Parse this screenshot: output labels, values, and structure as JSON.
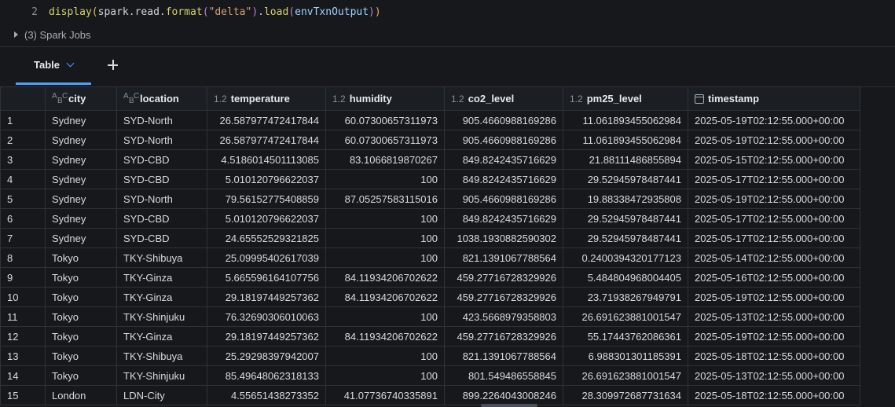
{
  "code": {
    "line_no": "2",
    "tokens": [
      "display",
      "(",
      "spark",
      ".",
      "read",
      ".",
      "format",
      "(",
      "\"delta\"",
      ")",
      ".",
      "load",
      "(",
      "envTxnOutput",
      ")",
      ")"
    ]
  },
  "jobs": {
    "label": "(3) Spark Jobs"
  },
  "tabs": {
    "active": "Table",
    "add": "+"
  },
  "columns": [
    {
      "name": "city",
      "type": "string"
    },
    {
      "name": "location",
      "type": "string"
    },
    {
      "name": "temperature",
      "type": "number",
      "type_label": "1.2"
    },
    {
      "name": "humidity",
      "type": "number",
      "type_label": "1.2"
    },
    {
      "name": "co2_level",
      "type": "number",
      "type_label": "1.2"
    },
    {
      "name": "pm25_level",
      "type": "number",
      "type_label": "1.2"
    },
    {
      "name": "timestamp",
      "type": "timestamp"
    }
  ],
  "rows": [
    [
      "1",
      "Sydney",
      "SYD-North",
      "26.587977472417844",
      "60.07300657311973",
      "905.4660988169286",
      "11.061893455062984",
      "2025-05-19T02:12:55.000+00:00"
    ],
    [
      "2",
      "Sydney",
      "SYD-North",
      "26.587977472417844",
      "60.07300657311973",
      "905.4660988169286",
      "11.061893455062984",
      "2025-05-19T02:12:55.000+00:00"
    ],
    [
      "3",
      "Sydney",
      "SYD-CBD",
      "4.5186014501113085",
      "83.1066819870267",
      "849.8242435716629",
      "21.88111486855894",
      "2025-05-15T02:12:55.000+00:00"
    ],
    [
      "4",
      "Sydney",
      "SYD-CBD",
      "5.010120796622037",
      "100",
      "849.8242435716629",
      "29.52945978487441",
      "2025-05-17T02:12:55.000+00:00"
    ],
    [
      "5",
      "Sydney",
      "SYD-North",
      "79.56152775408859",
      "87.05257583115016",
      "905.4660988169286",
      "19.88338472935808",
      "2025-05-19T02:12:55.000+00:00"
    ],
    [
      "6",
      "Sydney",
      "SYD-CBD",
      "5.010120796622037",
      "100",
      "849.8242435716629",
      "29.52945978487441",
      "2025-05-17T02:12:55.000+00:00"
    ],
    [
      "7",
      "Sydney",
      "SYD-CBD",
      "24.65552529321825",
      "100",
      "1038.1930882590302",
      "29.52945978487441",
      "2025-05-17T02:12:55.000+00:00"
    ],
    [
      "8",
      "Tokyo",
      "TKY-Shibuya",
      "25.09995402617039",
      "100",
      "821.1391067788564",
      "0.2400394320177123",
      "2025-05-14T02:12:55.000+00:00"
    ],
    [
      "9",
      "Tokyo",
      "TKY-Ginza",
      "5.665596164107756",
      "84.11934206702622",
      "459.27716728329926",
      "5.484804968004405",
      "2025-05-16T02:12:55.000+00:00"
    ],
    [
      "10",
      "Tokyo",
      "TKY-Ginza",
      "29.18197449257362",
      "84.11934206702622",
      "459.27716728329926",
      "23.71938267949791",
      "2025-05-19T02:12:55.000+00:00"
    ],
    [
      "11",
      "Tokyo",
      "TKY-Shinjuku",
      "76.32690306010063",
      "100",
      "423.5668979358803",
      "26.691623881001547",
      "2025-05-13T02:12:55.000+00:00"
    ],
    [
      "12",
      "Tokyo",
      "TKY-Ginza",
      "29.18197449257362",
      "84.11934206702622",
      "459.27716728329926",
      "55.17443762086361",
      "2025-05-19T02:12:55.000+00:00"
    ],
    [
      "13",
      "Tokyo",
      "TKY-Shibuya",
      "25.29298397942007",
      "100",
      "821.1391067788564",
      "6.988301301185391",
      "2025-05-18T02:12:55.000+00:00"
    ],
    [
      "14",
      "Tokyo",
      "TKY-Shinjuku",
      "85.49648062318133",
      "100",
      "801.549486558845",
      "26.691623881001547",
      "2025-05-13T02:12:55.000+00:00"
    ],
    [
      "15",
      "London",
      "LDN-City",
      "4.55651438273352",
      "41.07736740335891",
      "899.2264043008246",
      "28.309972687731634",
      "2025-05-18T02:12:55.000+00:00"
    ]
  ]
}
